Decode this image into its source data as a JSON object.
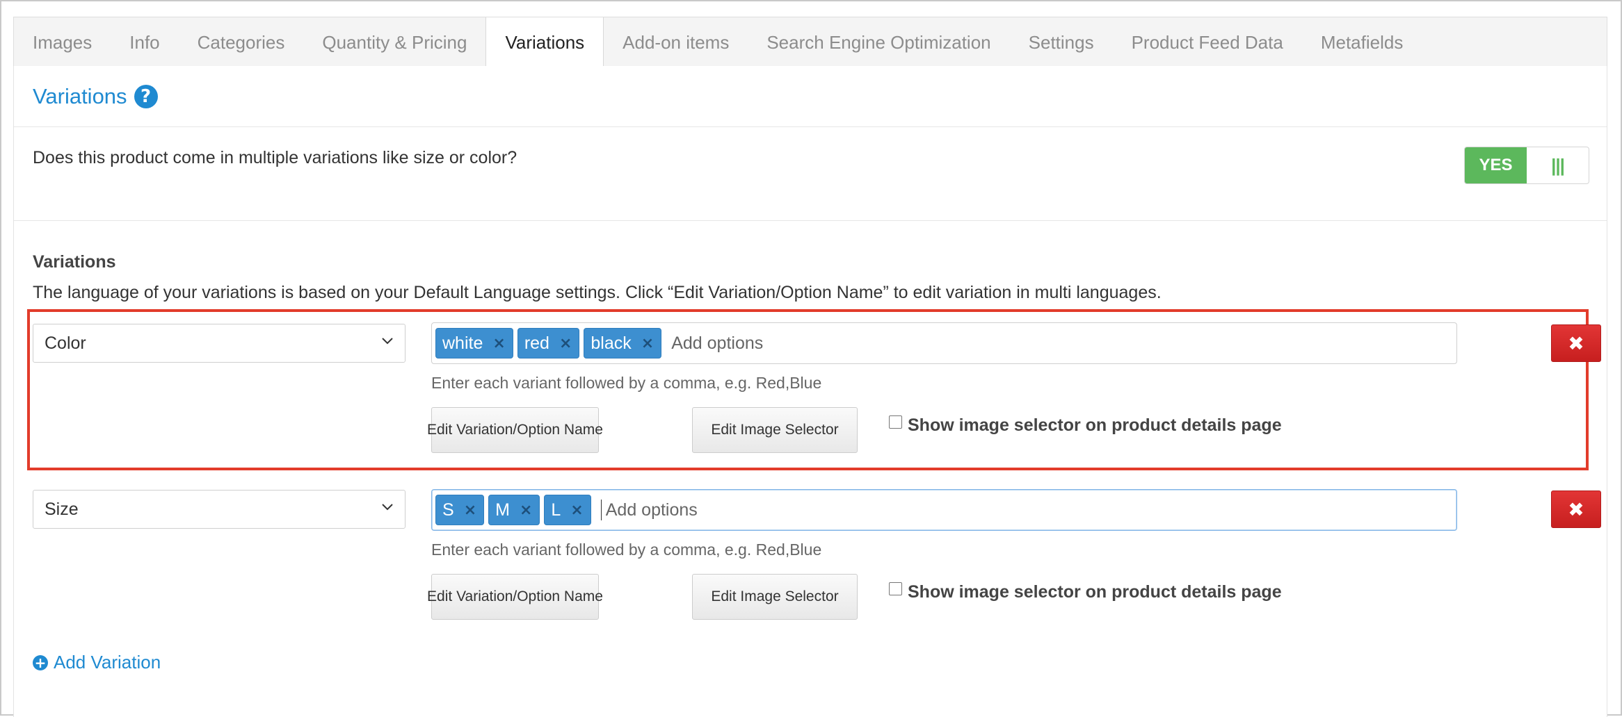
{
  "tabs": [
    {
      "label": "Images",
      "active": false
    },
    {
      "label": "Info",
      "active": false
    },
    {
      "label": "Categories",
      "active": false
    },
    {
      "label": "Quantity & Pricing",
      "active": false
    },
    {
      "label": "Variations",
      "active": true
    },
    {
      "label": "Add-on items",
      "active": false
    },
    {
      "label": "Search Engine Optimization",
      "active": false
    },
    {
      "label": "Settings",
      "active": false
    },
    {
      "label": "Product Feed Data",
      "active": false
    },
    {
      "label": "Metafields",
      "active": false
    }
  ],
  "section": {
    "title": "Variations",
    "help_icon": "?",
    "question": "Does this product come in multiple variations like size or color?",
    "toggle": {
      "yes_label": "YES",
      "handle": "|||",
      "value": true
    }
  },
  "variations_block": {
    "heading": "Variations",
    "description": "The language of your variations is based on your Default Language settings. Click “Edit Variation/Option Name” to edit variation in multi languages.",
    "rows": [
      {
        "name": "Color",
        "options": [
          "white",
          "red",
          "black"
        ],
        "placeholder": "Add options",
        "helper": "Enter each variant followed by a comma, e.g. Red,Blue",
        "edit_name_label": "Edit Variation/Option Name",
        "edit_image_label": "Edit Image Selector",
        "checkbox_label": "Show image selector on product details page",
        "checkbox_checked": false,
        "highlighted": true
      },
      {
        "name": "Size",
        "options": [
          "S",
          "M",
          "L"
        ],
        "placeholder": "Add options",
        "helper": "Enter each variant followed by a comma, e.g. Red,Blue",
        "edit_name_label": "Edit Variation/Option Name",
        "edit_image_label": "Edit Image Selector",
        "checkbox_label": "Show image selector on product details page",
        "checkbox_checked": false,
        "focused": true
      }
    ],
    "tag_remove_glyph": "×",
    "delete_glyph": "✖",
    "add_variation_label": "Add Variation",
    "add_icon": "+"
  },
  "colors": {
    "accent": "#1f8ad1",
    "tag": "#3d8fd0",
    "toggle_on": "#5cb85c",
    "delete": "#d32a2a",
    "highlight": "#e23c2b"
  }
}
